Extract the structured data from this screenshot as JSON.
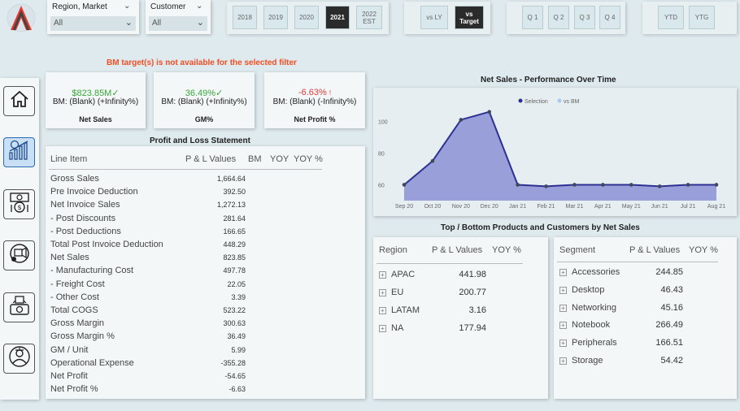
{
  "filters": {
    "region_market": {
      "title": "Region, Market",
      "value": "All"
    },
    "customer": {
      "title": "Customer",
      "value": "All"
    }
  },
  "years": [
    "2018",
    "2019",
    "2020",
    "2021",
    "2022\nEST"
  ],
  "year_selected": "2021",
  "compare": [
    "vs LY",
    "vs\nTarget"
  ],
  "compare_selected": "vs\nTarget",
  "quarters": [
    "Q 1",
    "Q 2",
    "Q 3",
    "Q 4"
  ],
  "ytd": [
    "YTD",
    "YTG"
  ],
  "message": "BM target(s) is not available for the selected filter",
  "kpis": [
    {
      "value": "$823.85M",
      "mark": "✓",
      "color": "#3aa83a",
      "bm": "BM: (Blank) (+Infinity%)",
      "label": "Net Sales"
    },
    {
      "value": "36.49%",
      "mark": "✓",
      "color": "#3aa83a",
      "bm": "BM: (Blank) (+Infinity%)",
      "label": "GM%"
    },
    {
      "value": "-6.63%",
      "mark": "!",
      "color": "#e23a3a",
      "bm": "BM: (Blank) (-Infinity%)",
      "label": "Net Profit %"
    }
  ],
  "pl": {
    "title": "Profit and Loss Statement",
    "headers": [
      "Line Item",
      "P & L Values",
      "BM",
      "YOY",
      "YOY %"
    ],
    "rows": [
      {
        "label": "Gross Sales",
        "value": "1,664.64"
      },
      {
        "label": "Pre Invoice Deduction",
        "value": "392.50"
      },
      {
        "label": "Net Invoice Sales",
        "value": "1,272.13"
      },
      {
        "label": " - Post Discounts",
        "value": "281.64"
      },
      {
        "label": " - Post Deductions",
        "value": "166.65"
      },
      {
        "label": "Total Post Invoice Deduction",
        "value": "448.29"
      },
      {
        "label": "Net Sales",
        "value": "823.85"
      },
      {
        "label": " - Manufacturing Cost",
        "value": "497.78"
      },
      {
        "label": " - Freight Cost",
        "value": "22.05"
      },
      {
        "label": " - Other Cost",
        "value": "3.39"
      },
      {
        "label": "Total COGS",
        "value": "523.22"
      },
      {
        "label": "Gross Margin",
        "value": "300.63"
      },
      {
        "label": "Gross Margin %",
        "value": "36.49"
      },
      {
        "label": "GM / Unit",
        "value": "5.99"
      },
      {
        "label": "Operational Expense",
        "value": "-355.28"
      },
      {
        "label": "Net Profit",
        "value": "-54.65"
      },
      {
        "label": "Net Profit %",
        "value": "-6.63"
      }
    ]
  },
  "chart_data": {
    "type": "area",
    "title": "Net Sales - Performance Over Time",
    "legend": [
      {
        "name": "Selection",
        "color": "#2e3192"
      },
      {
        "name": "vs BM",
        "color": "#a8c8ee"
      }
    ],
    "legend_position": "top-center",
    "categories": [
      "Sep 20",
      "Oct 20",
      "Nov 20",
      "Dec 20",
      "Jan 21",
      "Feb 21",
      "Mar 21",
      "Apr 21",
      "May 21",
      "Jun 21",
      "Jul 21",
      "Aug 21"
    ],
    "series": [
      {
        "name": "Selection",
        "values": [
          60,
          75,
          101,
          106,
          60,
          59,
          60,
          60,
          60,
          59,
          60,
          60
        ]
      }
    ],
    "yticks": [
      60,
      80,
      100
    ],
    "ylim": [
      50,
      112
    ],
    "area_color": "#8f96d6",
    "line_color": "#2e3192"
  },
  "bottom_title": "Top / Bottom Products and Customers by Net Sales",
  "region_table": {
    "headers": [
      "Region",
      "P & L Values",
      "YOY %"
    ],
    "rows": [
      {
        "name": "APAC",
        "value": "441.98"
      },
      {
        "name": "EU",
        "value": "200.77"
      },
      {
        "name": "LATAM",
        "value": "3.16"
      },
      {
        "name": "NA",
        "value": "177.94"
      }
    ]
  },
  "segment_table": {
    "headers": [
      "Segment",
      "P & L Values",
      "YOY %"
    ],
    "rows": [
      {
        "name": "Accessories",
        "value": "244.85"
      },
      {
        "name": "Desktop",
        "value": "46.43"
      },
      {
        "name": "Networking",
        "value": "45.16"
      },
      {
        "name": "Notebook",
        "value": "266.49"
      },
      {
        "name": "Peripherals",
        "value": "166.51"
      },
      {
        "name": "Storage",
        "value": "54.42"
      }
    ]
  },
  "nav": [
    {
      "name": "nav-home",
      "icon": "home-icon"
    },
    {
      "name": "nav-finance",
      "icon": "finance-chart-icon",
      "active": true
    },
    {
      "name": "nav-sales",
      "icon": "sales-money-icon"
    },
    {
      "name": "nav-marketing",
      "icon": "marketing-icon"
    },
    {
      "name": "nav-supply-chain",
      "icon": "supply-chain-icon"
    },
    {
      "name": "nav-executive",
      "icon": "executive-icon"
    }
  ]
}
